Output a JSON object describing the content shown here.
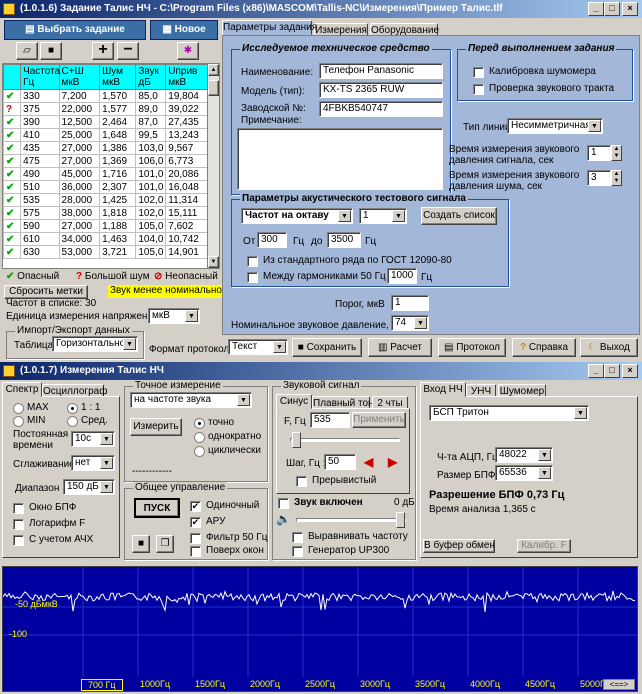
{
  "w1": {
    "title": "(1.0.1.6) Задание Талис НЧ - C:\\Program Files (x86)\\MASCOM\\Tallis-NC\\Измерения\\Пример Талис.tlf",
    "select_task": "Выбрать задание",
    "new_btn": "Новое",
    "tabs": [
      "Параметры задания",
      "Измерения",
      "Оборудование"
    ],
    "table": {
      "headers": [
        "Частота Гц",
        "С+Ш мкВ",
        "Шум мкВ",
        "Звук дБ",
        "Uприв мкВ"
      ],
      "rows": [
        {
          "s": "ok",
          "c": [
            "330",
            "7,200",
            "1,570",
            "85,0",
            "19,804"
          ]
        },
        {
          "s": "warn",
          "c": [
            "375",
            "22,000",
            "1,577",
            "89,0",
            "39,022"
          ]
        },
        {
          "s": "ok",
          "c": [
            "390",
            "12,500",
            "2,464",
            "87,0",
            "27,435"
          ]
        },
        {
          "s": "ok",
          "c": [
            "410",
            "25,000",
            "1,648",
            "99,5",
            "13,243"
          ]
        },
        {
          "s": "ok",
          "c": [
            "435",
            "27,000",
            "1,386",
            "103,0",
            "9,567"
          ]
        },
        {
          "s": "ok",
          "c": [
            "475",
            "27,000",
            "1,369",
            "106,0",
            "6,773"
          ]
        },
        {
          "s": "ok",
          "c": [
            "490",
            "45,000",
            "1,716",
            "101,0",
            "20,086"
          ]
        },
        {
          "s": "ok",
          "c": [
            "510",
            "36,000",
            "2,307",
            "101,0",
            "16,048"
          ]
        },
        {
          "s": "ok",
          "c": [
            "535",
            "28,000",
            "1,425",
            "102,0",
            "11,314"
          ]
        },
        {
          "s": "ok",
          "c": [
            "575",
            "38,000",
            "1,818",
            "102,0",
            "15,111"
          ]
        },
        {
          "s": "ok",
          "c": [
            "590",
            "27,000",
            "1,188",
            "105,0",
            "7,602"
          ]
        },
        {
          "s": "ok",
          "c": [
            "610",
            "34,000",
            "1,463",
            "104,0",
            "10,742"
          ]
        },
        {
          "s": "ok",
          "c": [
            "630",
            "53,000",
            "3,721",
            "105,0",
            "14,901"
          ]
        }
      ]
    },
    "legend": {
      "danger": "Опасный",
      "noise": "Большой шум",
      "unsafe": "Неопасный"
    },
    "reset_marks": "Сбросить метки",
    "sound_low": "Звук менее номинального",
    "freq_count": "Частот в списке: 30",
    "unit_label": "Единица измерения напряжения",
    "unit_value": "мкВ",
    "import_group": "Импорт/Экспорт данных",
    "table_label": "Таблица",
    "table_value": "Горизонтально",
    "format_label": "Формат протокола",
    "format_value": "Текст",
    "buttons": {
      "save": "Сохранить",
      "calc": "Расчет",
      "protocol": "Протокол",
      "help": "Справка",
      "exit": "Выход"
    },
    "device": {
      "group": "Исследуемое техническое средство",
      "name_l": "Наименование:",
      "name_v": "Телефон Panasonic",
      "model_l": "Модель (тип):",
      "model_v": "KX-TS 2365 RUW",
      "serial_l": "Заводской №:",
      "serial_v": "4FBKB540747",
      "note_l": "Примечание:"
    },
    "before": {
      "group": "Перед выполнением задания",
      "c1": "Калибровка шумомера",
      "c2": "Проверка звукового тракта"
    },
    "line_l": "Тип линии",
    "line_v": "Несимметричная",
    "t1_l": "Время измерения звукового давления сигнала, сек",
    "t1_v": "1",
    "t2_l": "Время измерения звукового давления шума, сек",
    "t2_v": "3",
    "acoustic": {
      "group": "Параметры акустического тестового сигнала",
      "mode": "Частот на октаву",
      "mode_n": "1",
      "create": "Создать список",
      "from": "От",
      "from_v": "300",
      "hz": "Гц",
      "to": "до",
      "to_v": "3500",
      "gost": "Из стандартного ряда по ГОСТ 12090-80",
      "harm": "Между гармониками 50 Гц до",
      "harm_v": "1000"
    },
    "thresh_l": "Порог, мкВ",
    "thresh_v": "1",
    "nom_l": "Номинальное звуковое давление, дБ",
    "nom_v": "74"
  },
  "w2": {
    "title": "(1.0.1.7) Измерения Талис НЧ",
    "tabs": [
      "Спектр",
      "Осциллограф"
    ],
    "spec": {
      "max": "MAX",
      "ratio": "1 : 1",
      "min": "MIN",
      "avg": "Сред.",
      "const_l": "Постоянная времени",
      "const_v": "10с",
      "smooth_l": "Сглаживание",
      "smooth_v": "нет",
      "range_l": "Диапазон",
      "range_v": "150 дБ",
      "win": "Окно БПФ",
      "log": "Логарифм F",
      "afc": "С учетом АЧХ"
    },
    "precise": {
      "group": "Точное измерение",
      "sel": "на частоте звука",
      "measure": "Измерить",
      "r1": "точно",
      "r2": "однократно",
      "r3": "циклически",
      "dash": "------------"
    },
    "general": {
      "group": "Общее управление",
      "start": "ПУСК",
      "single": "Одиночный",
      "aru": "АРУ",
      "filter": "Фильтр 50 Гц",
      "top": "Поверх окон"
    },
    "sound": {
      "group": "Звуковой сигнал",
      "tabs": [
        "Синус",
        "Плавный тон",
        "2 чты"
      ],
      "f_l": "F, Гц",
      "f_v": "535",
      "apply": "Применить",
      "step_l": "Шаг, Гц :",
      "step_v": "50",
      "inter": "Прерывистый",
      "enabled": "Звук включен",
      "db": "0 дБ",
      "align": "Выравнивать частоту",
      "gen": "Генератор UP300"
    },
    "input": {
      "tabs": [
        "Вход НЧ",
        "УНЧ",
        "Шумомер"
      ],
      "sel": "БСП Тритон",
      "adc_l": "Ч-та АЦП, Гц",
      "adc_v": "48022",
      "fft_l": "Размер БПФ",
      "fft_v": "65536",
      "res": "Разрешение БПФ 0,73 Гц",
      "time": "Время анализа 1,365 с",
      "buffer": "В буфер обмена",
      "calib": "Калибр. F"
    },
    "plot": {
      "ylabel": "-50 дБмкВ",
      "y2": "-100",
      "xticks": [
        "700 Гц",
        "1000Гц",
        "1500Гц",
        "2000Гц",
        "2500Гц",
        "3000Гц",
        "3500Гц",
        "4000Гц",
        "4500Гц",
        "5000Гц"
      ],
      "scroll": "<==>"
    }
  },
  "colors": {
    "title_start": "#0a246a",
    "table_header": "#00ffff",
    "panel_blue": "#a3b7d8",
    "spectrum_bg": "#0000a0",
    "trace": "#ffffff",
    "axis_text": "#ffff00"
  }
}
